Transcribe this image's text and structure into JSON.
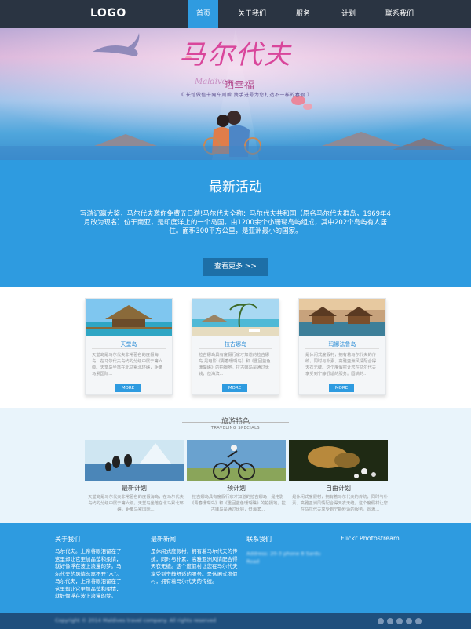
{
  "nav": {
    "logo": "LOGO",
    "items": [
      {
        "label": "首页",
        "active": true
      },
      {
        "label": "关于我们",
        "active": false
      },
      {
        "label": "服务",
        "active": false
      },
      {
        "label": "计划",
        "active": false
      },
      {
        "label": "联系我们",
        "active": false
      }
    ],
    "accent": "#2f9be0",
    "bg": "#2a3442"
  },
  "hero": {
    "title": "马尔代夫",
    "subtitle": "晒幸福",
    "english": "Maldives",
    "tagline": "《 长恺做信十网车则赠 携手进号为您打造不一样的春假 》"
  },
  "activity": {
    "title": "最新活动",
    "text": "写游记赢大奖，马尔代夫邀你免费五日游!马尔代夫全称：马尔代夫共和国（原名马尔代夫群岛，1969年4月改为现名）位于南亚，是印度洋上的一个岛国。由1200余个小珊瑚岛屿组成，其中202个岛屿有人居住。面积300平方公里，是亚洲最小的国家。",
    "button": "查看更多 >>",
    "bg": "#2e9be0"
  },
  "islands": [
    {
      "title": "天堂岛",
      "text": "天堂岛是马尔代夫非常著名的度假海岛，在马尔代夫岛屿的分级中属于第六级。天堂岛坐落在北马累北环礁，距离马累国际...",
      "button": "MORE"
    },
    {
      "title": "拉古娜岛",
      "text": "拉古娜岛具有度假行家才知道的拉古娜岛,是电影《青春珊瑚岛》和《重回蓝色珊瑚礁》的拍摄地。拉古娜岛是通过世钱，但海滨...",
      "button": "MORE"
    },
    {
      "title": "玛娜法鲁岛",
      "text": "是休闲式度假村，拥有着马尔代夫的传统，同时与朴素、高雅亚洲风情配合得天衣无缝。这个度假村让您在马尔代夫享受到宁静舒适的服务。圆满的...",
      "button": "MORE"
    }
  ],
  "specials": {
    "title": "旅游特色",
    "subtitle": "TRAVELING SPECIALS",
    "items": [
      {
        "name": "最新计划",
        "text": "天堂岛是马尔代夫非常著名的度假海岛，在马尔代夫岛屿的分级中属于第六级。天堂岛坐落在北马累北环礁，距离马累国际..."
      },
      {
        "name": "预计划",
        "text": "拉古娜岛具有度假行家才知道的拉古娜岛，是电影《青春珊瑚岛》和《重回蓝色珊瑚礁》的拍摄地。拉古娜岛是通过世钱，但海滨..."
      },
      {
        "name": "自由计划",
        "text": "是休闲式度假村，拥有着马尔代夫的传统，同时与朴素、高雅亚洲风情配合得天衣无缝。这个度假村让您在马尔代夫享受到宁静舒适的服务。圆满..."
      }
    ]
  },
  "footer": {
    "about": {
      "head": "关于我们",
      "text": "马尔代夫。上帝将眼泪留在了这里却让它更加晶莹和柔情，就好像浮在波上浪漫的梦。马尔代夫的风情总离不开“水”。马尔代夫，上帝将眼泪留在了这里却让它更加晶莹和柔情，就好像浮在波上浪漫的梦。"
    },
    "news": {
      "head": "最新新闻",
      "text": "是休闲式度假村，拥有着马尔代夫的传统，同时与朴素、高雅亚洲风情配合得天衣无缝。这个度假村让您在马尔代夫享受到宁静舒适的服务。是休闲式度假村，拥有着马尔代夫的传统。"
    },
    "contact": {
      "head": "联系我们",
      "text": "Address: 20-3 phone 8 Sardu Road"
    },
    "flickr": {
      "head": "Flickr Photostream"
    }
  },
  "bottom": {
    "copyright": "Copyright © 2014 Maldives travel company. All rights reserved"
  }
}
